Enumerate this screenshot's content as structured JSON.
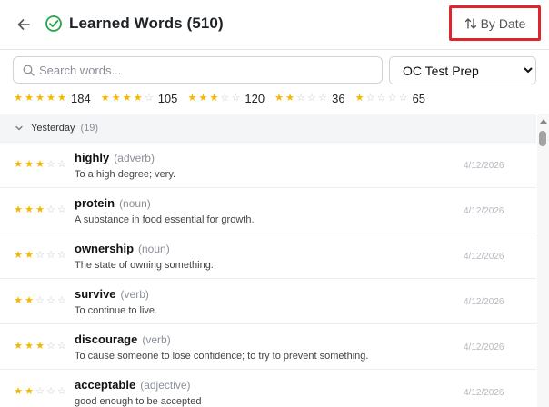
{
  "header": {
    "title": "Learned Words (510)",
    "sort_label": "By Date"
  },
  "search": {
    "placeholder": "Search words..."
  },
  "deck_select": {
    "selected": "OC Test Prep"
  },
  "filters": [
    {
      "stars": 5,
      "count": "184"
    },
    {
      "stars": 4,
      "count": "105"
    },
    {
      "stars": 3,
      "count": "120"
    },
    {
      "stars": 2,
      "count": "36"
    },
    {
      "stars": 1,
      "count": "65"
    }
  ],
  "group": {
    "label": "Yesterday",
    "count": "(19)"
  },
  "words": [
    {
      "word": "highly",
      "pos": "(adverb)",
      "definition": "To a high degree; very.",
      "date": "4/12/2026",
      "stars": 3
    },
    {
      "word": "protein",
      "pos": "(noun)",
      "definition": "A substance in food essential for growth.",
      "date": "4/12/2026",
      "stars": 3
    },
    {
      "word": "ownership",
      "pos": "(noun)",
      "definition": "The state of owning something.",
      "date": "4/12/2026",
      "stars": 2
    },
    {
      "word": "survive",
      "pos": "(verb)",
      "definition": "To continue to live.",
      "date": "4/12/2026",
      "stars": 2
    },
    {
      "word": "discourage",
      "pos": "(verb)",
      "definition": "To cause someone to lose confidence; to try to prevent something.",
      "date": "4/12/2026",
      "stars": 3
    },
    {
      "word": "acceptable",
      "pos": "(adjective)",
      "definition": "good enough to be accepted",
      "date": "4/12/2026",
      "stars": 2
    }
  ],
  "colors": {
    "star_on": "#f5b800",
    "star_off": "#c4c8ce",
    "highlight_box": "#e0242c",
    "check_green": "#22a84a"
  },
  "icons": {
    "back": "arrow-left-icon",
    "title": "check-circle-icon",
    "sort": "sort-arrows-icon",
    "search": "search-icon",
    "group": "chevron-down-icon"
  }
}
